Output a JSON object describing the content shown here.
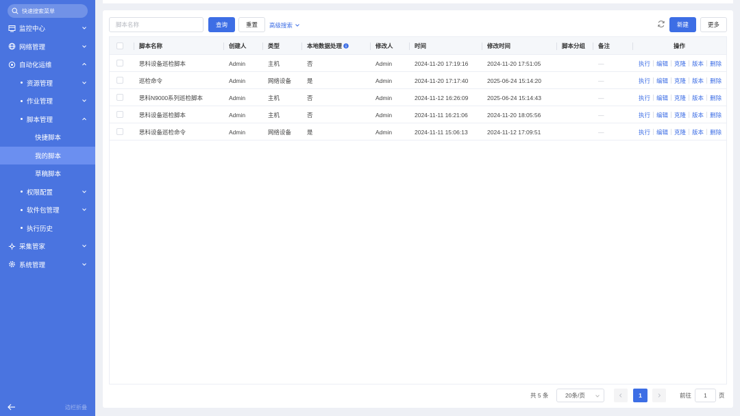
{
  "sidebar": {
    "search_placeholder": "快速搜索菜单",
    "items": [
      {
        "label": "监控中心"
      },
      {
        "label": "网络管理"
      },
      {
        "label": "自动化运维"
      },
      {
        "label": "资源管理"
      },
      {
        "label": "作业管理"
      },
      {
        "label": "脚本管理"
      },
      {
        "label": "快捷脚本"
      },
      {
        "label": "我的脚本"
      },
      {
        "label": "草稿脚本"
      },
      {
        "label": "权限配置"
      },
      {
        "label": "软件包管理"
      },
      {
        "label": "执行历史"
      },
      {
        "label": "采集管家"
      },
      {
        "label": "系统管理"
      }
    ],
    "collapse_label": "边栏折叠"
  },
  "toolbar": {
    "keyword_placeholder": "脚本名称",
    "query_label": "查询",
    "reset_label": "重置",
    "advanced_label": "高级搜索",
    "new_label": "新建",
    "more_label": "更多"
  },
  "table": {
    "headers": {
      "name": "脚本名称",
      "creator": "创建人",
      "type": "类型",
      "local": "本地数据处理",
      "modifier": "修改人",
      "time": "时间",
      "mtime": "修改时间",
      "group": "脚本分组",
      "remark": "备注",
      "ops": "操作"
    },
    "rows": [
      {
        "name": "思科设备巡检脚本",
        "creator": "Admin",
        "type": "主机",
        "local": "否",
        "modifier": "Admin",
        "time": "2024-11-20 17:19:16",
        "mtime": "2024-11-20 17:51:05",
        "group": "",
        "remark": "—"
      },
      {
        "name": "巡检命令",
        "creator": "Admin",
        "type": "网络设备",
        "local": "是",
        "modifier": "Admin",
        "time": "2024-11-20 17:17:40",
        "mtime": "2025-06-24 15:14:20",
        "group": "",
        "remark": "—"
      },
      {
        "name": "思科N9000系列巡检脚本",
        "creator": "Admin",
        "type": "主机",
        "local": "否",
        "modifier": "Admin",
        "time": "2024-11-12 16:26:09",
        "mtime": "2025-06-24 15:14:43",
        "group": "",
        "remark": "—"
      },
      {
        "name": "思科设备巡检脚本",
        "creator": "Admin",
        "type": "主机",
        "local": "否",
        "modifier": "Admin",
        "time": "2024-11-11 16:21:06",
        "mtime": "2024-11-20 18:05:56",
        "group": "",
        "remark": "—"
      },
      {
        "name": "思科设备巡检命令",
        "creator": "Admin",
        "type": "网络设备",
        "local": "是",
        "modifier": "Admin",
        "time": "2024-11-11 15:06:13",
        "mtime": "2024-11-12 17:09:51",
        "group": "",
        "remark": "—"
      }
    ],
    "ops": {
      "execute": "执行",
      "edit": "编辑",
      "clone": "克隆",
      "version": "版本",
      "delete": "删除"
    }
  },
  "pagination": {
    "total": "共 5 条",
    "page_size": "20条/页",
    "current_page": "1",
    "goto_prefix": "前往",
    "goto_value": "1",
    "goto_suffix": "页"
  },
  "colors": {
    "sidebar": "#4a74e0",
    "primary": "#3d6ee5",
    "active_item": "#6b8ff0"
  }
}
